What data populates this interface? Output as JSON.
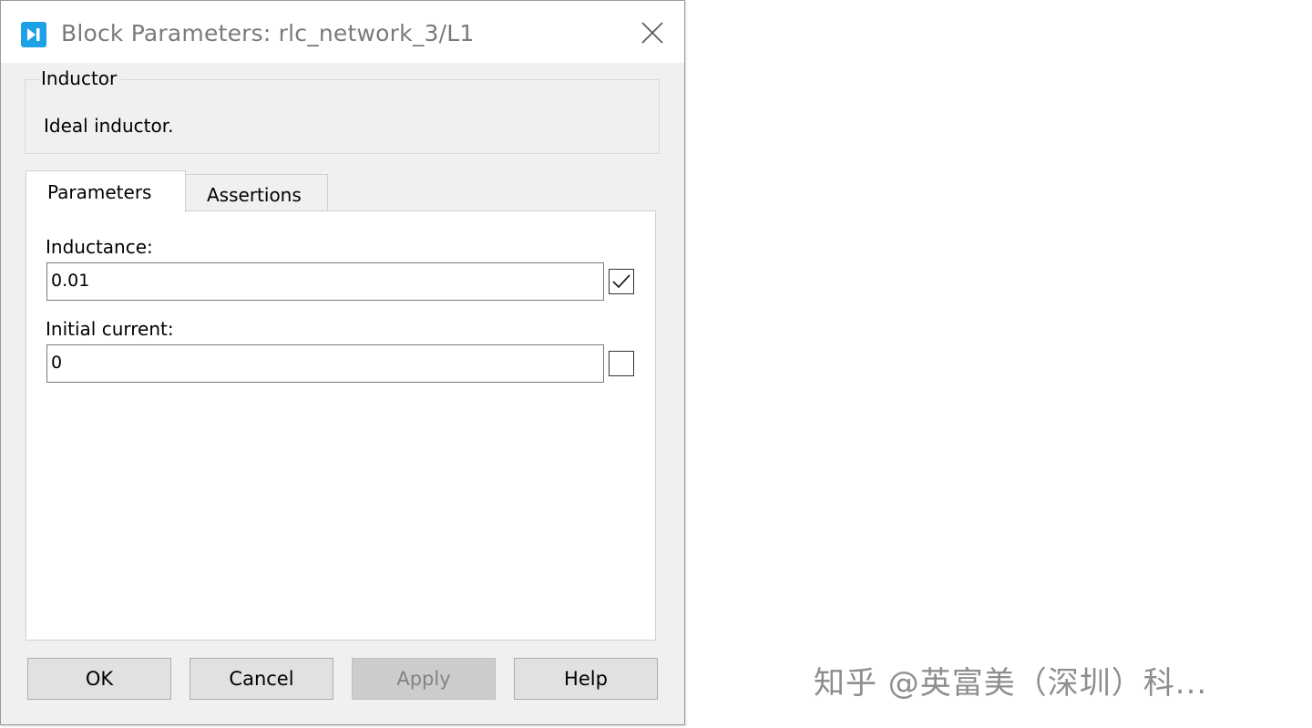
{
  "window": {
    "title": "Block Parameters: rlc_network_3/L1",
    "app_icon": "simulink-block-icon",
    "close_icon": "close-icon"
  },
  "group": {
    "legend": "Inductor",
    "description": "Ideal inductor."
  },
  "tabs": [
    {
      "label": "Parameters",
      "active": true
    },
    {
      "label": "Assertions",
      "active": false
    }
  ],
  "fields": [
    {
      "label": "Inductance:",
      "value": "0.01",
      "checked": true
    },
    {
      "label": "Initial current:",
      "value": "0",
      "checked": false
    }
  ],
  "buttons": {
    "ok": "OK",
    "cancel": "Cancel",
    "apply": "Apply",
    "help": "Help"
  },
  "watermark": "知乎 @英富美（深圳）科...",
  "colors": {
    "icon_accent": "#1ea0e6",
    "dialog_bg": "#f0f0f0",
    "disabled_text": "#838383"
  }
}
